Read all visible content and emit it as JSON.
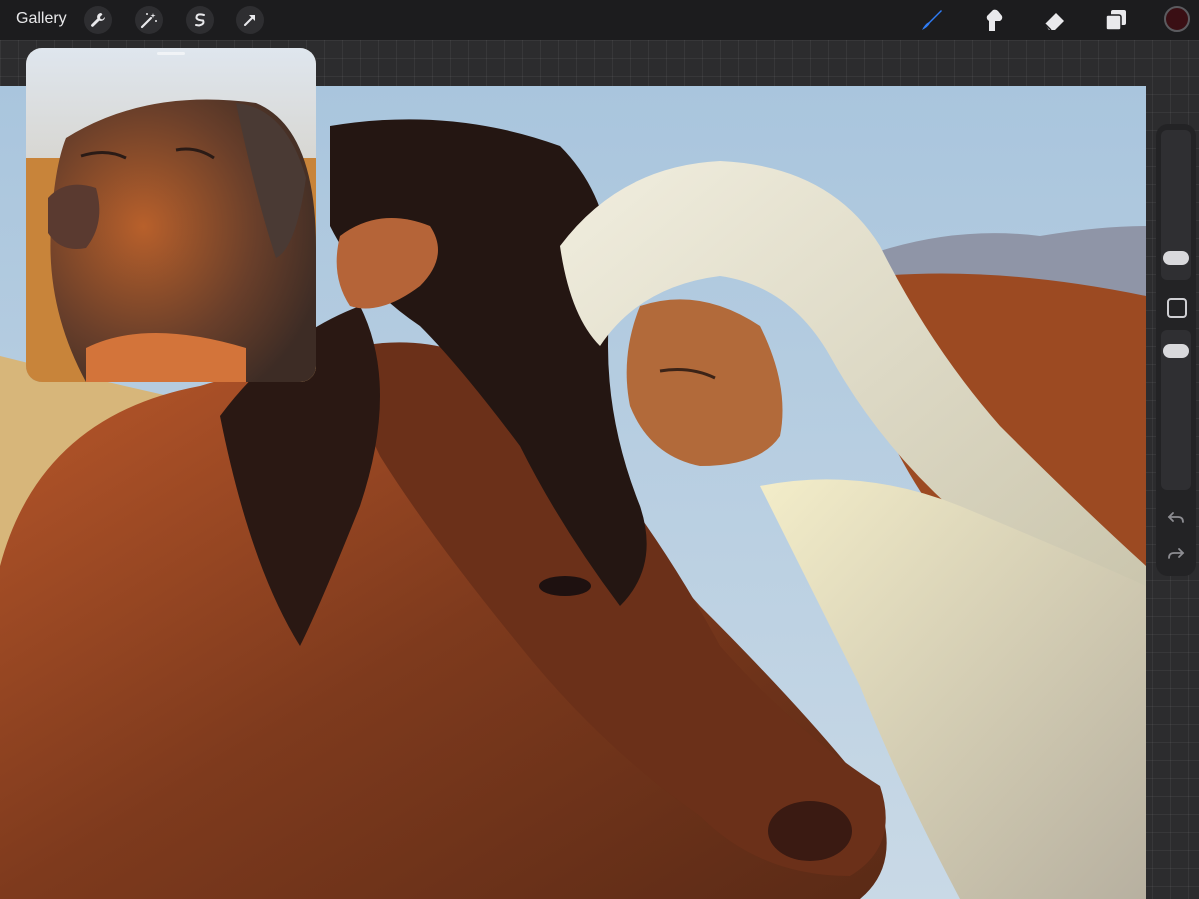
{
  "topbar": {
    "gallery_label": "Gallery",
    "left_tools": [
      "wrench-icon",
      "magic-wand-icon",
      "selection-icon",
      "transform-arrow-icon"
    ],
    "right_tools": [
      "brush-icon",
      "smudge-icon",
      "eraser-icon",
      "layers-icon"
    ],
    "active_tool": "brush",
    "active_color": "#3a0f14"
  },
  "sidebar": {
    "controls": [
      "brush-size-slider",
      "modify-button",
      "opacity-slider",
      "undo-icon",
      "redo-icon"
    ]
  },
  "canvas": {
    "artwork": "painting",
    "reference": "reference-photo"
  },
  "colors": {
    "accent": "#2f7cf6",
    "toolbar_bg": "#1c1c1e",
    "sidebar_bg": "#232325"
  }
}
